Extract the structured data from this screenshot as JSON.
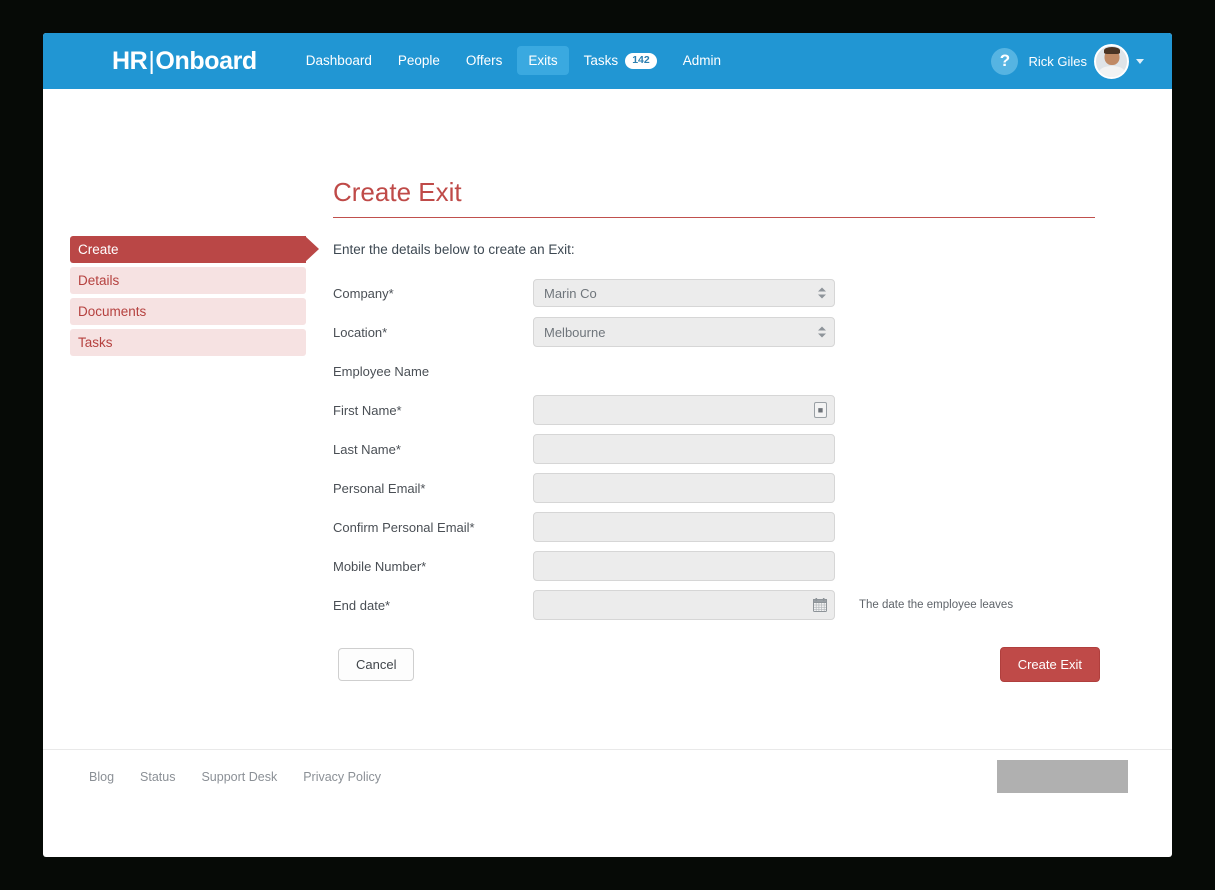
{
  "brand": {
    "primary": "HR",
    "separator": "|",
    "secondary": "Onboard"
  },
  "navbar": {
    "links": [
      {
        "label": "Dashboard",
        "active": false
      },
      {
        "label": "People",
        "active": false
      },
      {
        "label": "Offers",
        "active": false
      },
      {
        "label": "Exits",
        "active": true
      },
      {
        "label": "Tasks",
        "badge": "142",
        "active": false
      },
      {
        "label": "Admin",
        "active": false
      }
    ],
    "help_icon": "question-mark-icon",
    "user_name": "Rick Giles",
    "avatar": "user-avatar-photo",
    "caret": "chevron-down-icon"
  },
  "sidebar": {
    "steps": [
      {
        "label": "Create",
        "active": true
      },
      {
        "label": "Details",
        "active": false
      },
      {
        "label": "Documents",
        "active": false
      },
      {
        "label": "Tasks",
        "active": false
      }
    ]
  },
  "main": {
    "title": "Create Exit",
    "intro": "Enter the details below to create an Exit:",
    "fields": {
      "company": {
        "label": "Company*",
        "value": "Marin Co",
        "type": "select"
      },
      "location": {
        "label": "Location*",
        "value": "Melbourne",
        "type": "select"
      },
      "employee_name_heading": "Employee Name",
      "first_name": {
        "label": "First Name*",
        "value": "",
        "placeholder": ""
      },
      "last_name": {
        "label": "Last Name*",
        "value": "",
        "placeholder": ""
      },
      "personal_email": {
        "label": "Personal Email*",
        "value": "",
        "placeholder": ""
      },
      "confirm_personal_email": {
        "label": "Confirm Personal Email*",
        "value": "",
        "placeholder": ""
      },
      "mobile_number": {
        "label": "Mobile Number*",
        "value": "",
        "placeholder": ""
      },
      "end_date": {
        "label": "End date*",
        "value": "",
        "placeholder": "",
        "help": "The date the employee leaves",
        "icon": "calendar-icon"
      }
    },
    "actions": {
      "cancel": "Cancel",
      "submit": "Create Exit"
    }
  },
  "footer": {
    "links": [
      "Blog",
      "Status",
      "Support Desk",
      "Privacy Policy"
    ]
  },
  "colors": {
    "navbar_blue": "#2196d3",
    "nav_active_blue": "#3aa9e0",
    "brand_red": "#bf4a48",
    "step_active_red": "#ba4746",
    "step_inactive_pink": "#f6e2e2",
    "field_gray": "#ececec",
    "page_frame_dark": "#060a06"
  }
}
